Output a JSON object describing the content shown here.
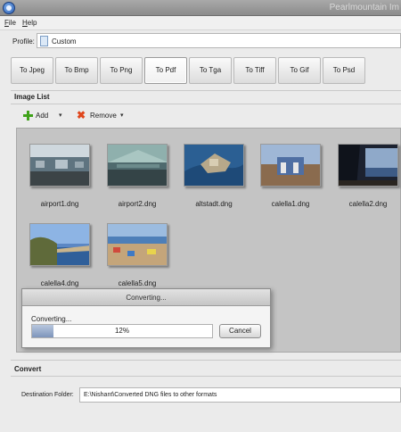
{
  "window": {
    "title": "Pearlmountain Im"
  },
  "menu": {
    "items": [
      "File",
      "Help"
    ]
  },
  "profile": {
    "label": "Profile:",
    "value": "Custom"
  },
  "formats": {
    "buttons": [
      "To Jpeg",
      "To Bmp",
      "To Png",
      "To Pdf",
      "To Tga",
      "To Tiff",
      "To Gif",
      "To Psd"
    ],
    "selected": "To Pdf"
  },
  "image_list": {
    "title": "Image List",
    "add_label": "Add",
    "remove_label": "Remove",
    "items": [
      {
        "name": "airport1.dng"
      },
      {
        "name": "airport2.dng"
      },
      {
        "name": "altstadt.dng"
      },
      {
        "name": "calella1.dng"
      },
      {
        "name": "calella2.dng"
      },
      {
        "name": "calella4.dng"
      },
      {
        "name": "calella5.dng"
      }
    ]
  },
  "dialog": {
    "title": "Converting...",
    "message": "Converting...",
    "progress": 12,
    "progress_text": "12%",
    "cancel_label": "Cancel"
  },
  "convert": {
    "title": "Convert",
    "dest_label": "Destination Folder:",
    "dest_value": "E:\\Nishant\\Converted DNG files to other formats"
  }
}
